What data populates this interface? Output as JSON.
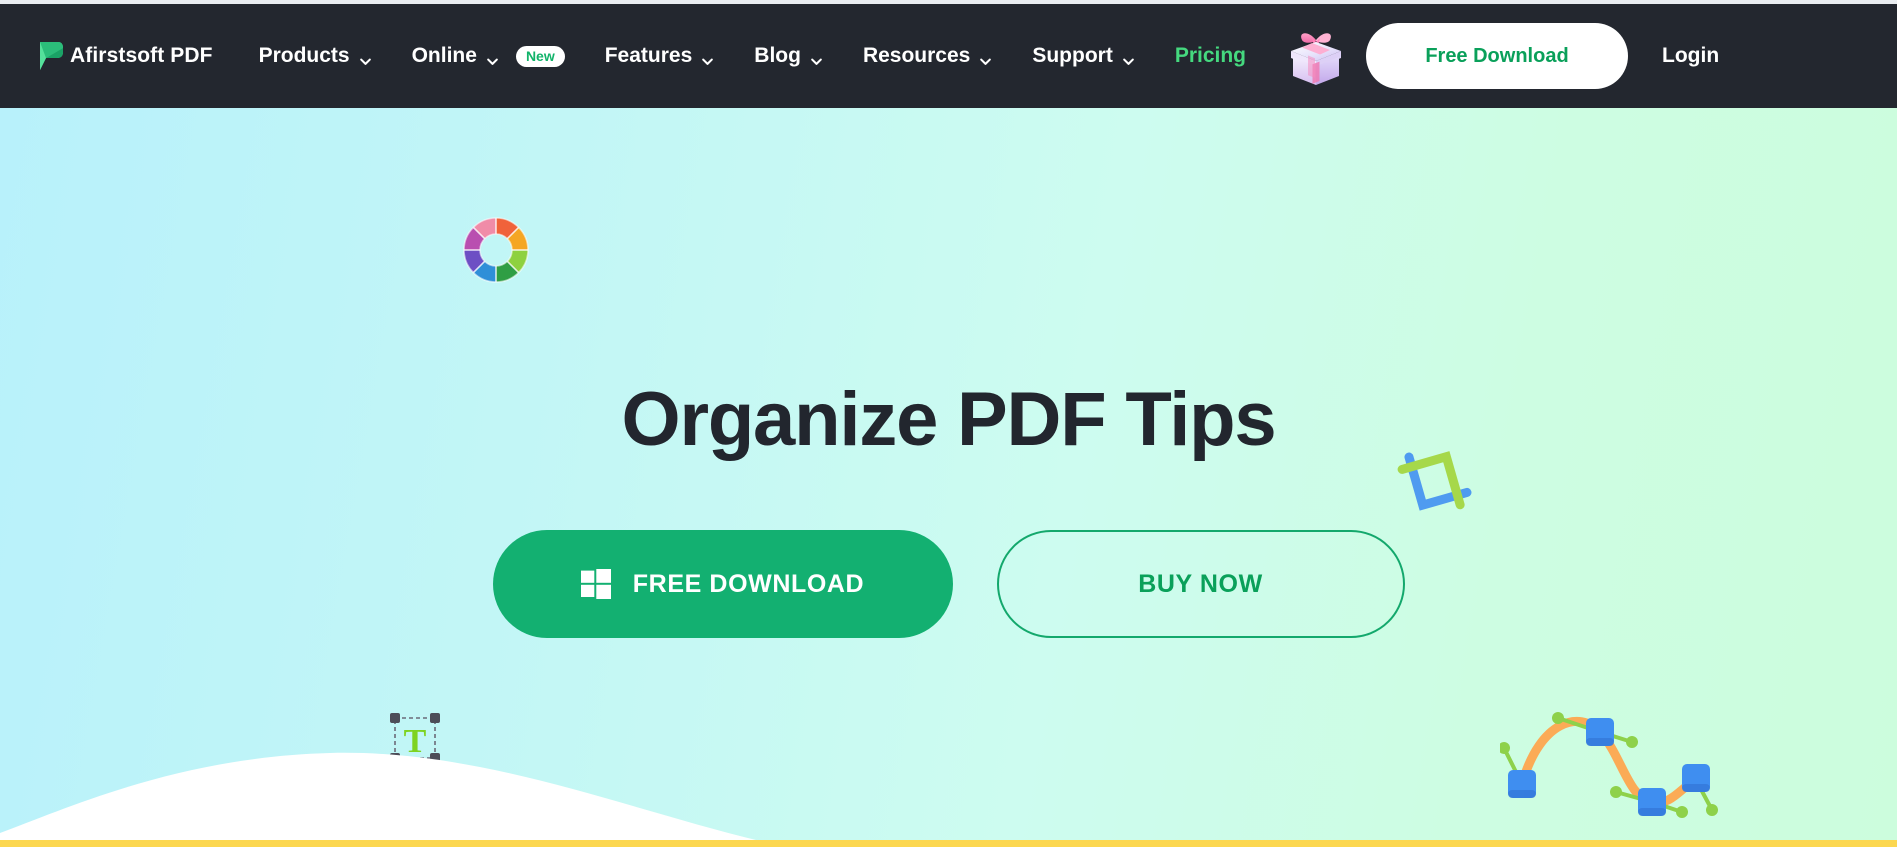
{
  "brand": {
    "name": "Afirstsoft PDF",
    "logo_icon": "afirstsoft-leaf-logo"
  },
  "nav": {
    "items": [
      {
        "label": "Products",
        "has_dropdown": true,
        "badge": null,
        "accent": false
      },
      {
        "label": "Online",
        "has_dropdown": true,
        "badge": "New",
        "accent": false
      },
      {
        "label": "Features",
        "has_dropdown": true,
        "badge": null,
        "accent": false
      },
      {
        "label": "Blog",
        "has_dropdown": true,
        "badge": null,
        "accent": false
      },
      {
        "label": "Resources",
        "has_dropdown": true,
        "badge": null,
        "accent": false
      },
      {
        "label": "Support",
        "has_dropdown": true,
        "badge": null,
        "accent": false
      },
      {
        "label": "Pricing",
        "has_dropdown": false,
        "badge": null,
        "accent": true
      }
    ],
    "gift_icon": "gift-box-icon",
    "free_download_label": "Free Download",
    "login_label": "Login"
  },
  "hero": {
    "title": "Organize PDF Tips",
    "primary_cta": {
      "label": "FREE DOWNLOAD",
      "icon": "windows-logo-icon"
    },
    "secondary_cta": {
      "label": "BUY NOW"
    },
    "decorations": [
      {
        "name": "color-wheel-icon",
        "description": "rainbow segmented donut ring"
      },
      {
        "name": "crop-tool-icon",
        "description": "blue and green crop brackets"
      },
      {
        "name": "text-tool-icon",
        "description": "green letter T inside dashed selection box"
      },
      {
        "name": "bezier-curve-icon",
        "description": "orange curve with blue anchor squares and green handles"
      }
    ]
  },
  "colors": {
    "navbar_bg": "#23272f",
    "accent_green": "#13b071",
    "pricing_green": "#45d97f",
    "hero_gradient_start": "#b8f1fb",
    "hero_gradient_end": "#ccfddd",
    "title_dark": "#22262e",
    "gold_bar": "#fcd750",
    "badge_text": "#12b36a"
  }
}
